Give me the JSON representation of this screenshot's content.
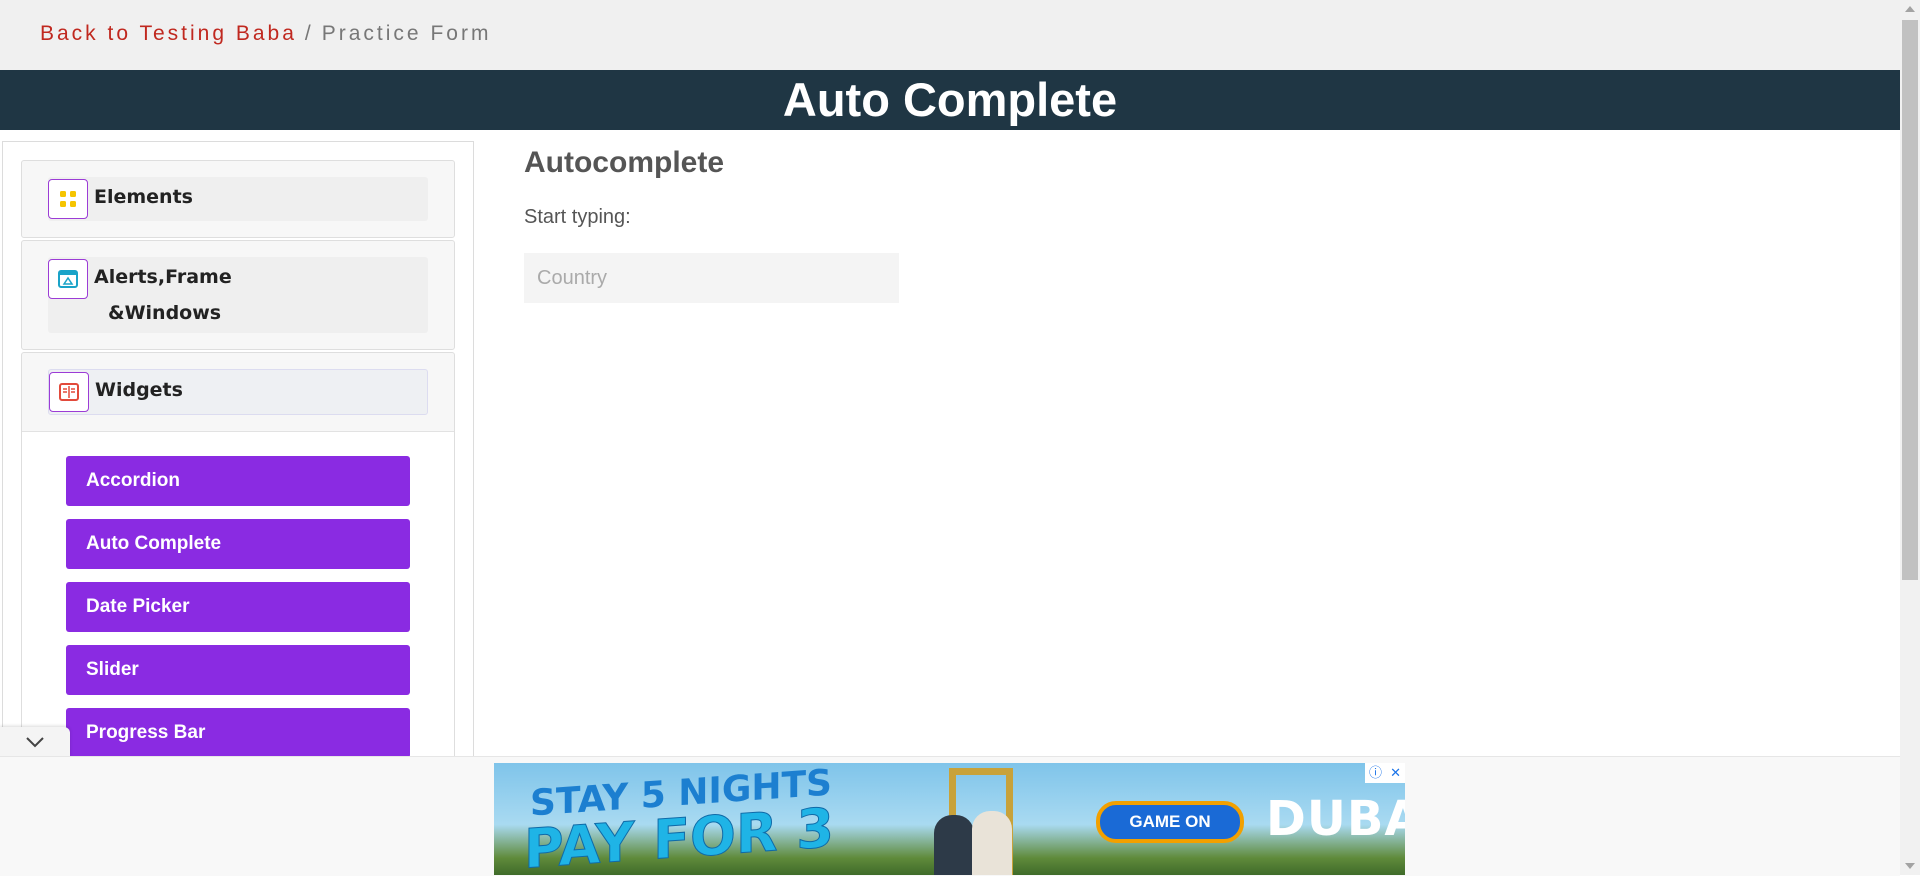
{
  "breadcrumb": {
    "back_link": "Back to Testing Baba",
    "separator": "/",
    "current": "Practice Form"
  },
  "page_title": "Auto Complete",
  "sidebar": {
    "groups": [
      {
        "label": "Elements",
        "icon": "grid-icon"
      },
      {
        "label_line1": "Alerts,Frame",
        "label_line2": "&Windows",
        "icon": "window-icon"
      },
      {
        "label": "Widgets",
        "icon": "widget-icon"
      }
    ],
    "widgets_items": [
      "Accordion",
      "Auto Complete",
      "Date Picker",
      "Slider",
      "Progress Bar"
    ]
  },
  "main": {
    "heading": "Autocomplete",
    "label": "Start typing:",
    "input_placeholder": "Country",
    "input_value": ""
  },
  "ad": {
    "line1": "STAY 5 NIGHTS",
    "line2": "PAY FOR 3",
    "button": "GAME ON",
    "brand": "DUBAI"
  },
  "colors": {
    "accent_purple": "#8a2be2",
    "title_bar": "#1f3644",
    "breadcrumb_link": "#c0281f"
  }
}
